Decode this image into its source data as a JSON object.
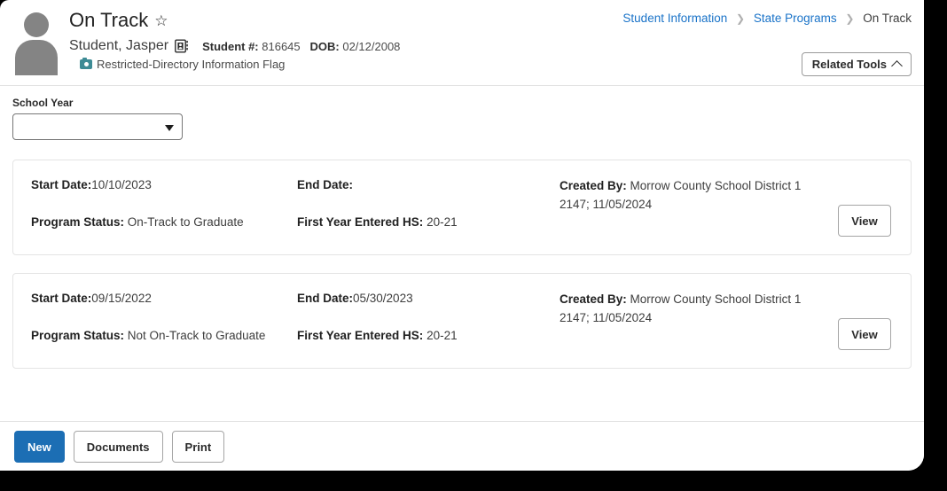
{
  "window": {
    "background": "#ffffff",
    "accent_blue": "#1c6eb4",
    "link_blue": "#1a73c8",
    "flag_teal": "#3d8b95"
  },
  "header": {
    "page_title": "On Track",
    "favorite_icon": "star-icon",
    "avatar_icon": "person-avatar-icon",
    "student_name": "Student, Jasper",
    "contact_icon": "contact-card-icon",
    "student_number_label": "Student #:",
    "student_number_value": "816645",
    "dob_label": "DOB:",
    "dob_value": "02/12/2008",
    "flag_icon": "camera-icon",
    "flag_text": "Restricted-Directory Information Flag",
    "breadcrumb": {
      "items": [
        {
          "label": "Student Information",
          "link": true
        },
        {
          "label": "State Programs",
          "link": true
        },
        {
          "label": "On Track",
          "link": false
        }
      ],
      "separator": "›"
    },
    "related_tools_label": "Related Tools",
    "related_tools_chevron": "chevron-up-icon"
  },
  "filters": {
    "school_year_label": "School Year",
    "school_year_value": "",
    "school_year_placeholder": "",
    "dropdown_caret_icon": "caret-down-icon"
  },
  "records": [
    {
      "start_date_label": "Start Date:",
      "start_date_value": "10/10/2023",
      "end_date_label": "End Date:",
      "end_date_value": "",
      "program_status_label": "Program Status:",
      "program_status_value": "On-Track to Graduate",
      "first_year_label": "First Year Entered HS:",
      "first_year_value": "20-21",
      "created_by_label": "Created By:",
      "created_by_value": "Morrow County School District 1 2147; 11/05/2024",
      "view_label": "View"
    },
    {
      "start_date_label": "Start Date:",
      "start_date_value": "09/15/2022",
      "end_date_label": "End Date:",
      "end_date_value": "05/30/2023",
      "program_status_label": "Program Status:",
      "program_status_value": "Not On-Track to Graduate",
      "first_year_label": "First Year Entered HS:",
      "first_year_value": "20-21",
      "created_by_label": "Created By:",
      "created_by_value": "Morrow County School District 1 2147; 11/05/2024",
      "view_label": "View"
    }
  ],
  "footer": {
    "new_label": "New",
    "documents_label": "Documents",
    "print_label": "Print"
  }
}
